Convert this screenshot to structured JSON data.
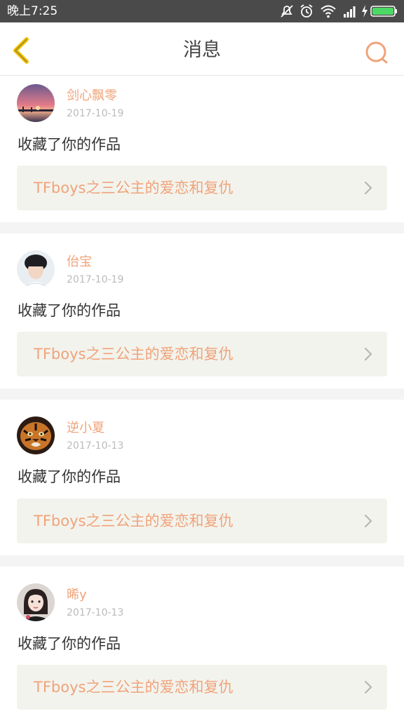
{
  "status_bar": {
    "time": "晚上7:25"
  },
  "header": {
    "title": "消息"
  },
  "colors": {
    "accent": "#f0a37a",
    "back_arrow": "#f2c200",
    "status_bar_bg": "#4a4a4a",
    "battery_green": "#4cd964"
  },
  "messages": [
    {
      "username": "剑心飘零",
      "date": "2017-10-19",
      "action": "收藏了你的作品",
      "work_title": "TFboys之三公主的爱恋和复仇"
    },
    {
      "username": "佁宝",
      "date": "2017-10-19",
      "action": "收藏了你的作品",
      "work_title": "TFboys之三公主的爱恋和复仇"
    },
    {
      "username": "逆小夏",
      "date": "2017-10-13",
      "action": "收藏了你的作品",
      "work_title": "TFboys之三公主的爱恋和复仇"
    },
    {
      "username": "晞y",
      "date": "2017-10-13",
      "action": "收藏了你的作品",
      "work_title": "TFboys之三公主的爱恋和复仇"
    }
  ]
}
